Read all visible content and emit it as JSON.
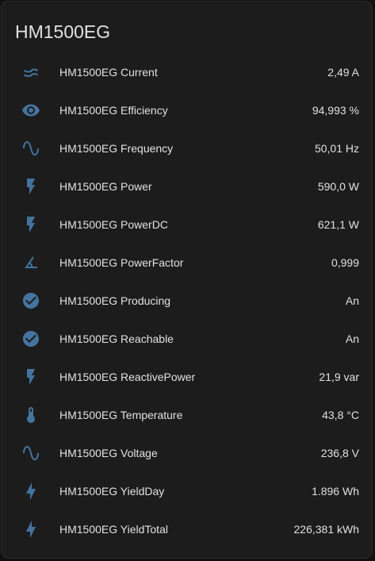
{
  "card": {
    "title": "HM1500EG"
  },
  "colors": {
    "icon": "#44739e",
    "text": "#e1e1e1",
    "card_bg": "#1c1c1c"
  },
  "entities": [
    {
      "icon": "current-ac-icon",
      "label": "HM1500EG Current",
      "value": "2,49 A"
    },
    {
      "icon": "eye-icon",
      "label": "HM1500EG Efficiency",
      "value": "94,993 %"
    },
    {
      "icon": "sine-wave-icon",
      "label": "HM1500EG Frequency",
      "value": "50,01 Hz"
    },
    {
      "icon": "flash-icon",
      "label": "HM1500EG Power",
      "value": "590,0 W"
    },
    {
      "icon": "flash-icon",
      "label": "HM1500EG PowerDC",
      "value": "621,1 W"
    },
    {
      "icon": "angle-acute-icon",
      "label": "HM1500EG PowerFactor",
      "value": "0,999"
    },
    {
      "icon": "check-circle-icon",
      "label": "HM1500EG Producing",
      "value": "An"
    },
    {
      "icon": "check-circle-icon",
      "label": "HM1500EG Reachable",
      "value": "An"
    },
    {
      "icon": "flash-icon",
      "label": "HM1500EG ReactivePower",
      "value": "21,9 var"
    },
    {
      "icon": "thermometer-icon",
      "label": "HM1500EG Temperature",
      "value": "43,8 °C"
    },
    {
      "icon": "sine-wave-icon",
      "label": "HM1500EG Voltage",
      "value": "236,8 V"
    },
    {
      "icon": "lightning-bolt-icon",
      "label": "HM1500EG YieldDay",
      "value": "1.896 Wh"
    },
    {
      "icon": "lightning-bolt-icon",
      "label": "HM1500EG YieldTotal",
      "value": "226,381 kWh"
    }
  ]
}
